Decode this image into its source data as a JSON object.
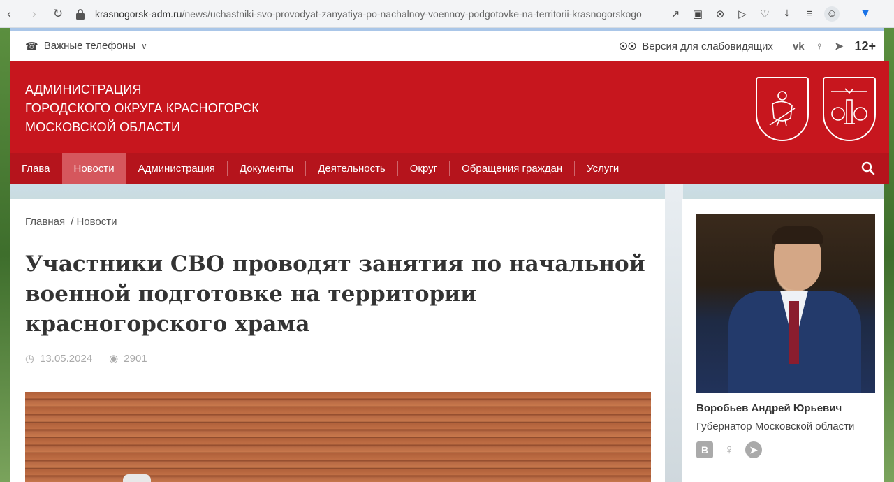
{
  "browser": {
    "url_domain": "krasnogorsk-adm.ru",
    "url_path": "/news/uchastniki-svo-provodyat-zanyatiya-po-nachalnoy-voennoy-podgotovke-na-territorii-krasnogorskogo"
  },
  "utility": {
    "phones_label": "Важные телефоны",
    "low_vision_label": "Версия для слабовидящих",
    "age_rating": "12+"
  },
  "header": {
    "org_line1": "АДМИНИСТРАЦИЯ",
    "org_line2": "ГОРОДСКОГО ОКРУГА КРАСНОГОРСК",
    "org_line3": "МОСКОВСКОЙ ОБЛАСТИ"
  },
  "nav": {
    "items": [
      "Глава",
      "Новости",
      "Администрация",
      "Документы",
      "Деятельность",
      "Округ",
      "Обращения граждан",
      "Услуги"
    ],
    "active": "Новости"
  },
  "article": {
    "breadcrumb_home": "Главная",
    "breadcrumb_sep": "/",
    "breadcrumb_current": "Новости",
    "title": "Участники СВО проводят занятия по начальной военной подготовке на территории красногорского храма",
    "date": "13.05.2024",
    "views": "2901"
  },
  "sidebar": {
    "governor_name": "Воробьев Андрей Юрьевич",
    "governor_role": "Губернатор Московской области"
  },
  "colors": {
    "brand_red": "#c7161e",
    "nav_red": "#b5141c",
    "nav_active": "#d5575d"
  }
}
